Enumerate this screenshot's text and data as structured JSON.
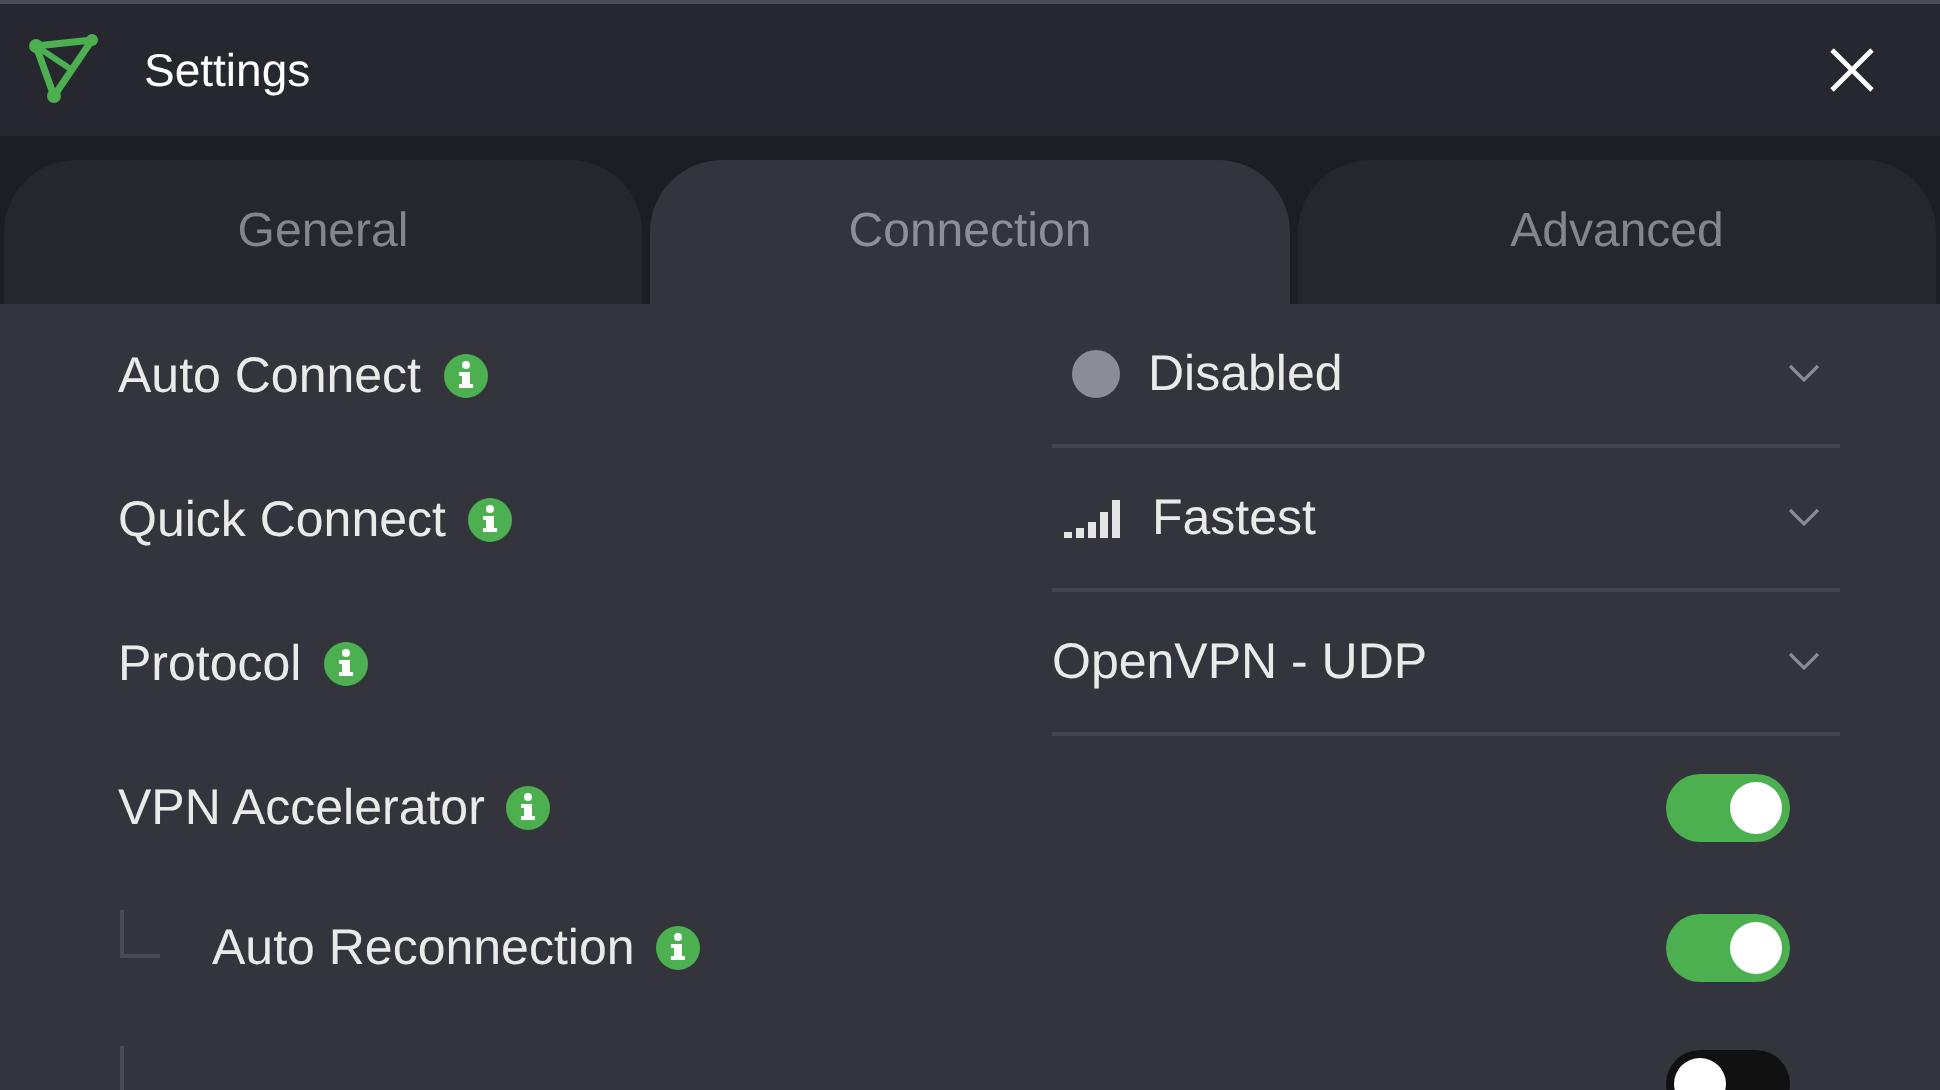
{
  "window": {
    "title": "Settings"
  },
  "tabs": [
    {
      "label": "General",
      "selected": false
    },
    {
      "label": "Connection",
      "selected": true
    },
    {
      "label": "Advanced",
      "selected": false
    }
  ],
  "settings": [
    {
      "kind": "statusdropdown",
      "label": "Auto Connect",
      "value": "Disabled"
    },
    {
      "kind": "speeddropdown",
      "label": "Quick Connect",
      "value": "Fastest"
    },
    {
      "kind": "dropdown",
      "label": "Protocol",
      "value": "OpenVPN - UDP"
    },
    {
      "kind": "toggle",
      "label": "VPN Accelerator",
      "on": true,
      "children": [
        {
          "kind": "toggle",
          "label": "Auto Reconnection",
          "on": true
        },
        {
          "kind": "toggle",
          "on": false
        }
      ]
    }
  ]
}
